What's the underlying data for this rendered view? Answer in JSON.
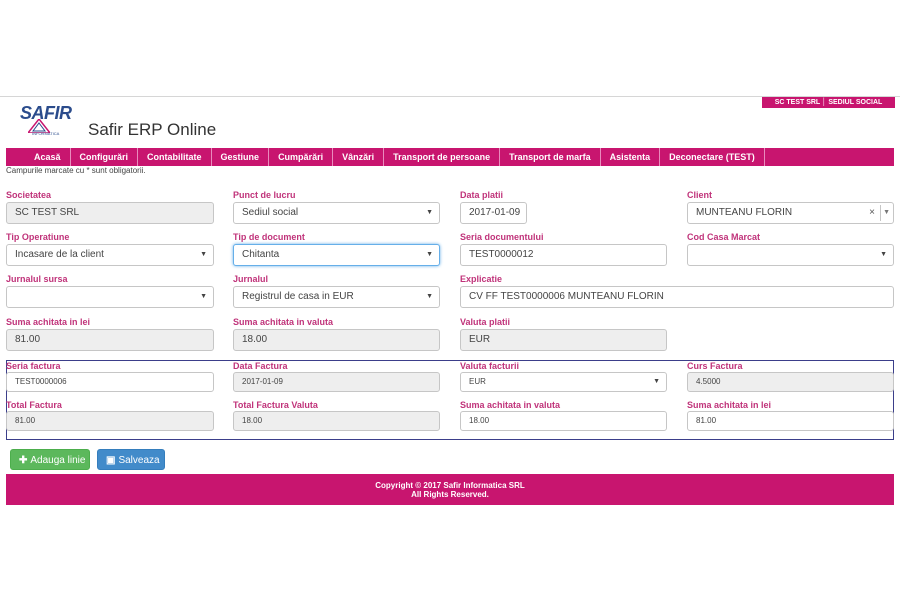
{
  "header": {
    "company_badge": "SC TEST SRL │ SEDIUL SOCIAL",
    "logo_text": "SAFIR",
    "logo_sub": "INFORMATICA",
    "app_title": "Safir ERP Online"
  },
  "nav": {
    "items": [
      "Acasă",
      "Configurări",
      "Contabilitate",
      "Gestiune",
      "Cumpărări",
      "Vânzări",
      "Transport de persoane",
      "Transport de marfa",
      "Asistenta",
      "Deconectare (TEST)"
    ]
  },
  "note": "Campurile marcate cu * sunt obligatorii.",
  "form": {
    "societatea": {
      "label": "Societatea",
      "value": "SC TEST SRL"
    },
    "punct_lucru": {
      "label": "Punct de lucru",
      "value": "Sediul social"
    },
    "data_platii": {
      "label": "Data platii",
      "value": "2017-01-09"
    },
    "client": {
      "label": "Client",
      "value": "MUNTEANU FLORIN",
      "clear": "×"
    },
    "tip_operatiune": {
      "label": "Tip Operatiune",
      "value": "Incasare de la client"
    },
    "tip_document": {
      "label": "Tip de document",
      "value": "Chitanta"
    },
    "seria_documentului": {
      "label": "Seria documentului",
      "value": "TEST0000012"
    },
    "cod_casa": {
      "label": "Cod Casa Marcat",
      "value": ""
    },
    "jurnalul_sursa": {
      "label": "Jurnalul sursa",
      "value": ""
    },
    "jurnalul": {
      "label": "Jurnalul",
      "value": "Registrul de casa in EUR"
    },
    "explicatie": {
      "label": "Explicatie",
      "value": "CV FF TEST0000006 MUNTEANU FLORIN"
    },
    "suma_lei": {
      "label": "Suma achitata in lei",
      "value": "81.00"
    },
    "suma_valuta": {
      "label": "Suma achitata in valuta",
      "value": "18.00"
    },
    "valuta_platii": {
      "label": "Valuta platii",
      "value": "EUR"
    }
  },
  "invoice": {
    "seria_factura": {
      "label": "Seria factura",
      "value": "TEST0000006"
    },
    "data_factura": {
      "label": "Data Factura",
      "value": "2017-01-09"
    },
    "valuta_facturii": {
      "label": "Valuta facturii",
      "value": "EUR"
    },
    "curs_factura": {
      "label": "Curs Factura",
      "value": "4.5000"
    },
    "total_factura": {
      "label": "Total Factura",
      "value": "81.00"
    },
    "total_factura_valuta": {
      "label": "Total Factura Valuta",
      "value": "18.00"
    },
    "suma_valuta": {
      "label": "Suma achitata in valuta",
      "value": "18.00"
    },
    "suma_lei": {
      "label": "Suma achitata in lei",
      "value": "81.00"
    }
  },
  "buttons": {
    "add_icon": "✚",
    "add_label": "Adauga linie",
    "save_icon": "▣",
    "save_label": "Salveaza"
  },
  "footer": {
    "line1": "Copyright © 2017 Safir Informatica SRL",
    "line2": "All Rights Reserved."
  },
  "colors": {
    "accent": "#c8156f",
    "label": "#c0337a",
    "add": "#5cb85c",
    "save": "#428bca",
    "frame": "#3b3e8a"
  },
  "icons": {
    "add": "plus-icon",
    "save": "floppy-disk-icon",
    "dropdown": "caret-down-icon",
    "clear": "close-icon"
  }
}
